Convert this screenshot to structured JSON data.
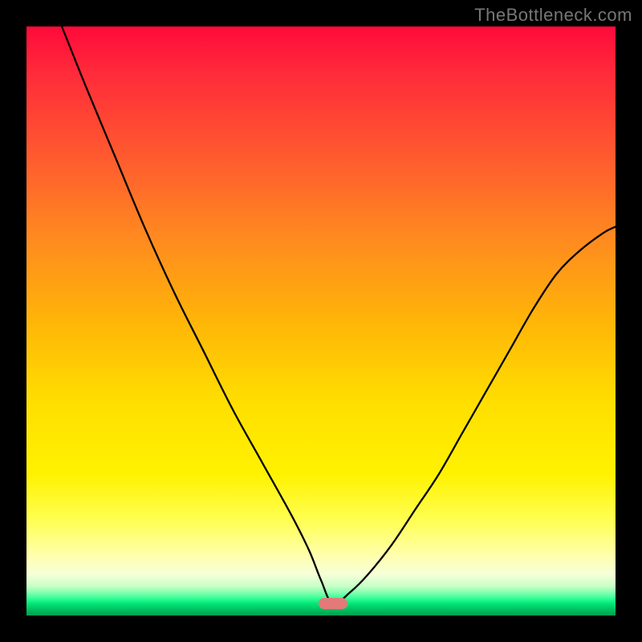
{
  "watermark": "TheBottleneck.com",
  "colors": {
    "frame_bg": "#000000",
    "curve_stroke": "#000000",
    "marker_fill": "#e37a7a",
    "gradient_stops": [
      "#ff0a3a",
      "#ff2b3a",
      "#ff5a2f",
      "#ff8a1f",
      "#ffb508",
      "#ffdf00",
      "#fff200",
      "#ffff55",
      "#ffffb0",
      "#f6ffd8",
      "#c8ffc8",
      "#8affb0",
      "#3aff9a",
      "#00e676",
      "#00c060",
      "#00a050"
    ]
  },
  "chart_data": {
    "type": "line",
    "title": "",
    "xlabel": "",
    "ylabel": "",
    "xlim": [
      0,
      100
    ],
    "ylim": [
      0,
      100
    ],
    "grid": false,
    "legend": false,
    "note": "Bottleneck-style V curve descending from top-left to a minimum then rising to the right. Values estimated from pixel positions; no axes or tick labels are shown.",
    "minimum": {
      "x": 52,
      "y": 2
    },
    "marker": {
      "x": 52,
      "y": 2,
      "shape": "pill",
      "color": "#e37a7a"
    },
    "series": [
      {
        "name": "left-branch",
        "x": [
          6,
          10,
          15,
          20,
          25,
          30,
          35,
          40,
          45,
          48,
          50,
          52
        ],
        "y": [
          100,
          90,
          78,
          66,
          55,
          45,
          35,
          26,
          17,
          11,
          6,
          2
        ]
      },
      {
        "name": "right-branch",
        "x": [
          52,
          55,
          58,
          62,
          66,
          70,
          74,
          78,
          82,
          86,
          90,
          94,
          98,
          100
        ],
        "y": [
          2,
          4,
          7,
          12,
          18,
          24,
          31,
          38,
          45,
          52,
          58,
          62,
          65,
          66
        ]
      }
    ]
  }
}
